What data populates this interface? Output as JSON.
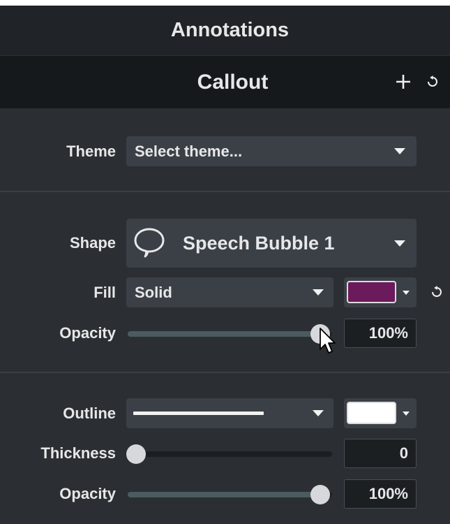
{
  "header": {
    "title": "Annotations"
  },
  "callout": {
    "title": "Callout",
    "add_icon": "plus-icon",
    "reset_icon": "reset-icon"
  },
  "theme": {
    "label": "Theme",
    "selected": "Select theme...",
    "dropdown_icon": "caret-down-icon"
  },
  "shape": {
    "label": "Shape",
    "selected": "Speech Bubble 1",
    "shape_icon": "speech-bubble-icon",
    "dropdown_icon": "caret-down-icon"
  },
  "fill": {
    "label": "Fill",
    "selected": "Solid",
    "color": "#6b1b5c",
    "reset_icon": "reset-icon"
  },
  "fill_opacity": {
    "label": "Opacity",
    "value": "100%",
    "level": 1.0
  },
  "outline": {
    "label": "Outline",
    "line_style_icon": "solid-line-icon",
    "color": "#ffffff"
  },
  "thickness": {
    "label": "Thickness",
    "value": "0",
    "level": 0
  },
  "outline_opacity": {
    "label": "Opacity",
    "value": "100%",
    "level": 1.0
  },
  "cursor": {
    "icon": "mouse-pointer-icon"
  },
  "colors": {
    "panel_bg": "#2b2f33",
    "header_bg": "#202327",
    "callout_bg": "#16191c",
    "control_bg": "#3b4047",
    "field_bg": "#1c1f22",
    "slider_fill": "#4b5c60",
    "slider_thumb": "#d6d8db",
    "text": "#e6e7e8"
  }
}
